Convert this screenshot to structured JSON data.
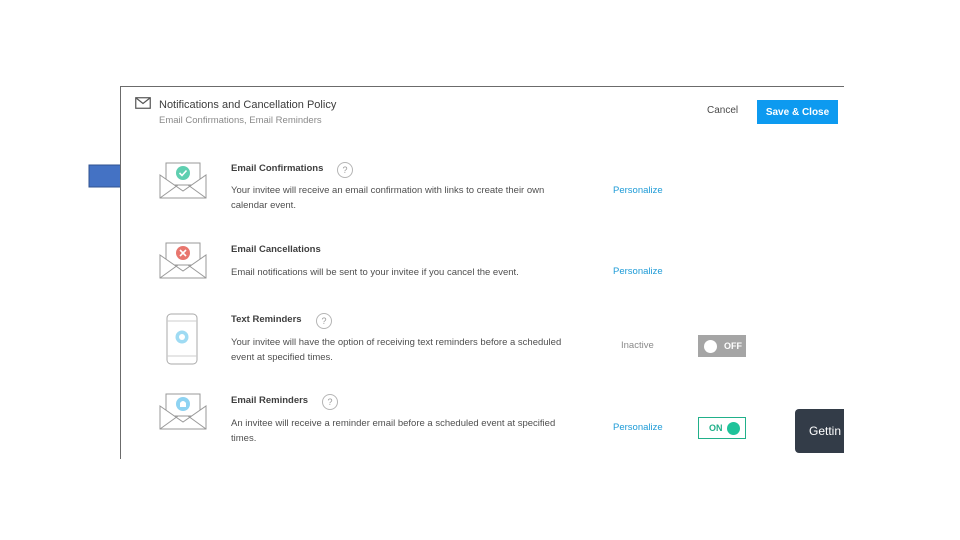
{
  "header": {
    "title": "Notifications and Cancellation Policy",
    "subtitle": "Email Confirmations, Email Reminders",
    "cancel_label": "Cancel",
    "save_label": "Save & Close"
  },
  "rows": [
    {
      "title": "Email Confirmations",
      "help": "?",
      "description": "Your invitee will receive an email confirmation with links to create their own calendar event.",
      "action": "Personalize",
      "icon": "envelope-check-icon",
      "icon_color": "#5fcfb0"
    },
    {
      "title": "Email Cancellations",
      "description": "Email notifications will be sent to your invitee if you cancel the event.",
      "action": "Personalize",
      "icon": "envelope-x-icon",
      "icon_color": "#e8766e"
    },
    {
      "title": "Text Reminders",
      "help": "?",
      "description": "Your invitee will have the option of receiving text reminders before a scheduled event at specified times.",
      "status": "Inactive",
      "toggle": "OFF",
      "icon": "phone-icon",
      "icon_color": "#9fdbf3"
    },
    {
      "title": "Email Reminders",
      "help": "?",
      "description": "An invitee will receive a reminder email before a scheduled event at specified times.",
      "action": "Personalize",
      "toggle": "ON",
      "icon": "envelope-bell-icon",
      "icon_color": "#8ed3f2"
    }
  ],
  "getting_started": {
    "label": "Gettin"
  },
  "colors": {
    "accent": "#0d9af0",
    "link": "#1e9bd7",
    "on": "#21b08a",
    "annotation_arrow": "#4472c4"
  },
  "annotations": [
    "arrow-right-icon",
    "arrow-down-icon"
  ]
}
